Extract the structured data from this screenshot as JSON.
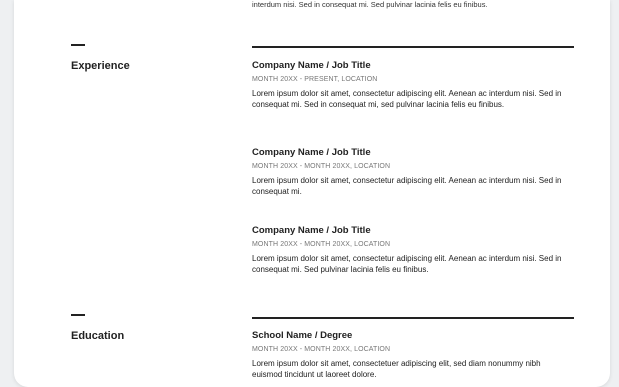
{
  "top_partial_text": "interdum nisi. Sed in consequat mi. Sed pulvinar lacinia felis eu finibus.",
  "sections": {
    "experience": {
      "title": "Experience",
      "entries": [
        {
          "title": "Company Name / Job Title",
          "meta": "MONTH 20XX - PRESENT, LOCATION",
          "desc": "Lorem ipsum dolor sit amet, consectetur adipiscing elit. Aenean ac interdum nisi. Sed in consequat mi. Sed in consequat mi, sed pulvinar lacinia felis eu finibus."
        },
        {
          "title": "Company Name / Job Title",
          "meta": "MONTH 20XX - MONTH 20XX, LOCATION",
          "desc": "Lorem ipsum dolor sit amet, consectetur adipiscing elit. Aenean ac interdum nisi. Sed in consequat mi."
        },
        {
          "title": "Company Name / Job Title",
          "meta": "MONTH 20XX - MONTH 20XX, LOCATION",
          "desc": "Lorem ipsum dolor sit amet, consectetur adipiscing elit. Aenean ac interdum nisi. Sed in consequat mi. Sed pulvinar lacinia felis eu finibus."
        }
      ]
    },
    "education": {
      "title": "Education",
      "entries": [
        {
          "title": "School Name / Degree",
          "meta": "MONTH 20XX - MONTH 20XX, LOCATION",
          "desc": "Lorem ipsum dolor sit amet, consectetuer adipiscing elit, sed diam nonummy nibh euismod tincidunt ut laoreet dolore."
        }
      ]
    }
  }
}
